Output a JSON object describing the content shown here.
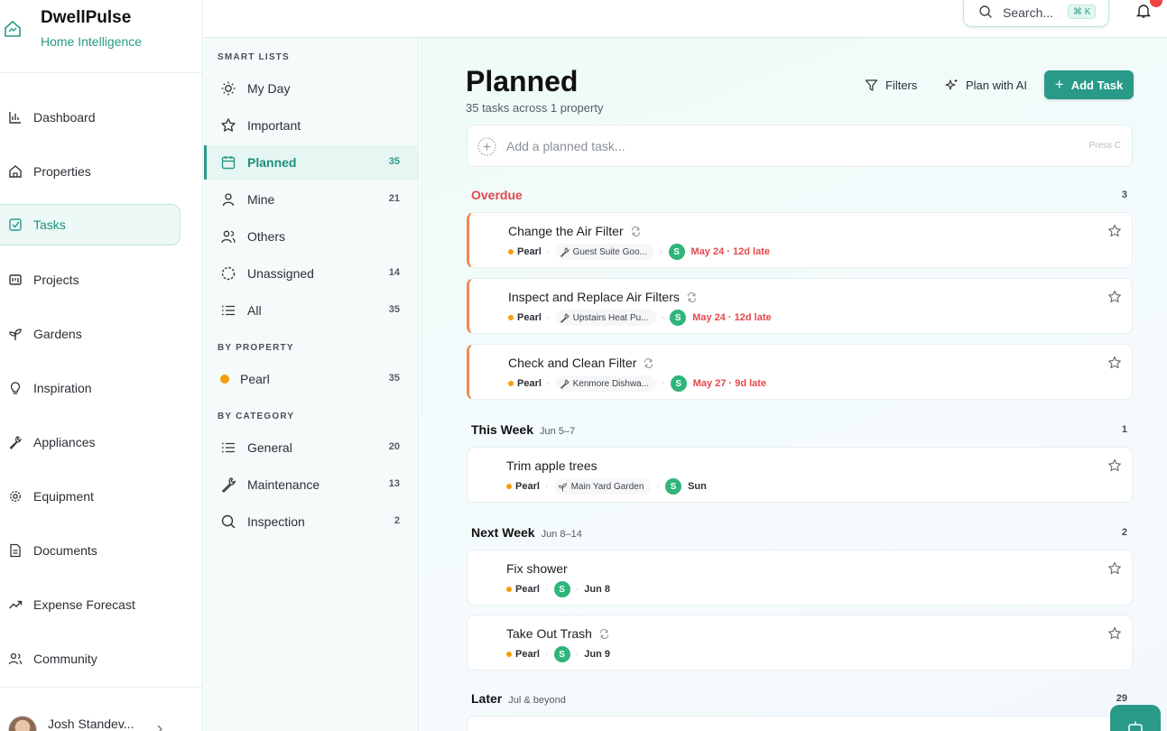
{
  "app": {
    "name": "DwellPulse",
    "tagline": "Home Intelligence"
  },
  "search": {
    "label": "Search...",
    "shortcut": "⌘ K"
  },
  "nav": {
    "items": [
      {
        "label": "Dashboard",
        "icon": "bar-chart-icon"
      },
      {
        "label": "Properties",
        "icon": "home-icon"
      },
      {
        "label": "Tasks",
        "icon": "checkbox-icon",
        "active": true
      },
      {
        "label": "Projects",
        "icon": "project-icon"
      },
      {
        "label": "Gardens",
        "icon": "sprout-icon"
      },
      {
        "label": "Inspiration",
        "icon": "lightbulb-icon"
      },
      {
        "label": "Appliances",
        "icon": "wrench-icon"
      },
      {
        "label": "Equipment",
        "icon": "gear-icon"
      },
      {
        "label": "Documents",
        "icon": "document-icon"
      },
      {
        "label": "Expense Forecast",
        "icon": "trend-icon"
      },
      {
        "label": "Community",
        "icon": "users-icon"
      }
    ]
  },
  "user": {
    "name": "Josh Standev..."
  },
  "lists": {
    "smart_heading": "SMART LISTS",
    "smart": [
      {
        "label": "My Day",
        "count": ""
      },
      {
        "label": "Important",
        "count": ""
      },
      {
        "label": "Planned",
        "count": "35",
        "active": true
      },
      {
        "label": "Mine",
        "count": "21"
      },
      {
        "label": "Others",
        "count": ""
      },
      {
        "label": "Unassigned",
        "count": "14"
      },
      {
        "label": "All",
        "count": "35"
      }
    ],
    "property_heading": "BY PROPERTY",
    "property": [
      {
        "label": "Pearl",
        "count": "35"
      }
    ],
    "category_heading": "BY CATEGORY",
    "category": [
      {
        "label": "General",
        "count": "20"
      },
      {
        "label": "Maintenance",
        "count": "13"
      },
      {
        "label": "Inspection",
        "count": "2"
      }
    ]
  },
  "main": {
    "title": "Planned",
    "subtitle": "35 tasks across 1 property",
    "filters_label": "Filters",
    "ai_label": "Plan with AI",
    "add_label": "Add Task",
    "add_placeholder": "Add a planned task...",
    "add_hint": "Press C"
  },
  "groups": [
    {
      "name": "Overdue",
      "range": "",
      "count": "3",
      "tasks": [
        {
          "title": "Change the Air Filter",
          "property": "Pearl",
          "chip": "Guest Suite Goo...",
          "assignee": "S",
          "due": "May 24 · 12d late"
        },
        {
          "title": "Inspect and Replace Air Filters",
          "property": "Pearl",
          "chip": "Upstairs Heat Pu...",
          "assignee": "S",
          "due": "May 24 · 12d late"
        },
        {
          "title": "Check and Clean Filter",
          "property": "Pearl",
          "chip": "Kenmore Dishwa...",
          "assignee": "S",
          "due": "May 27 · 9d late"
        }
      ]
    },
    {
      "name": "This Week",
      "range": "Jun 5–7",
      "count": "1",
      "tasks": [
        {
          "title": "Trim apple trees",
          "property": "Pearl",
          "chip": "Main Yard Garden",
          "assignee": "S",
          "due": "Sun"
        }
      ]
    },
    {
      "name": "Next Week",
      "range": "Jun 8–14",
      "count": "2",
      "tasks": [
        {
          "title": "Fix shower",
          "property": "Pearl",
          "assignee": "S",
          "due": "Jun 8"
        },
        {
          "title": "Take Out Trash",
          "property": "Pearl",
          "assignee": "S",
          "due": "Jun 9"
        }
      ]
    },
    {
      "name": "Later",
      "range": "Jul & beyond",
      "count": "29",
      "tasks": []
    }
  ]
}
